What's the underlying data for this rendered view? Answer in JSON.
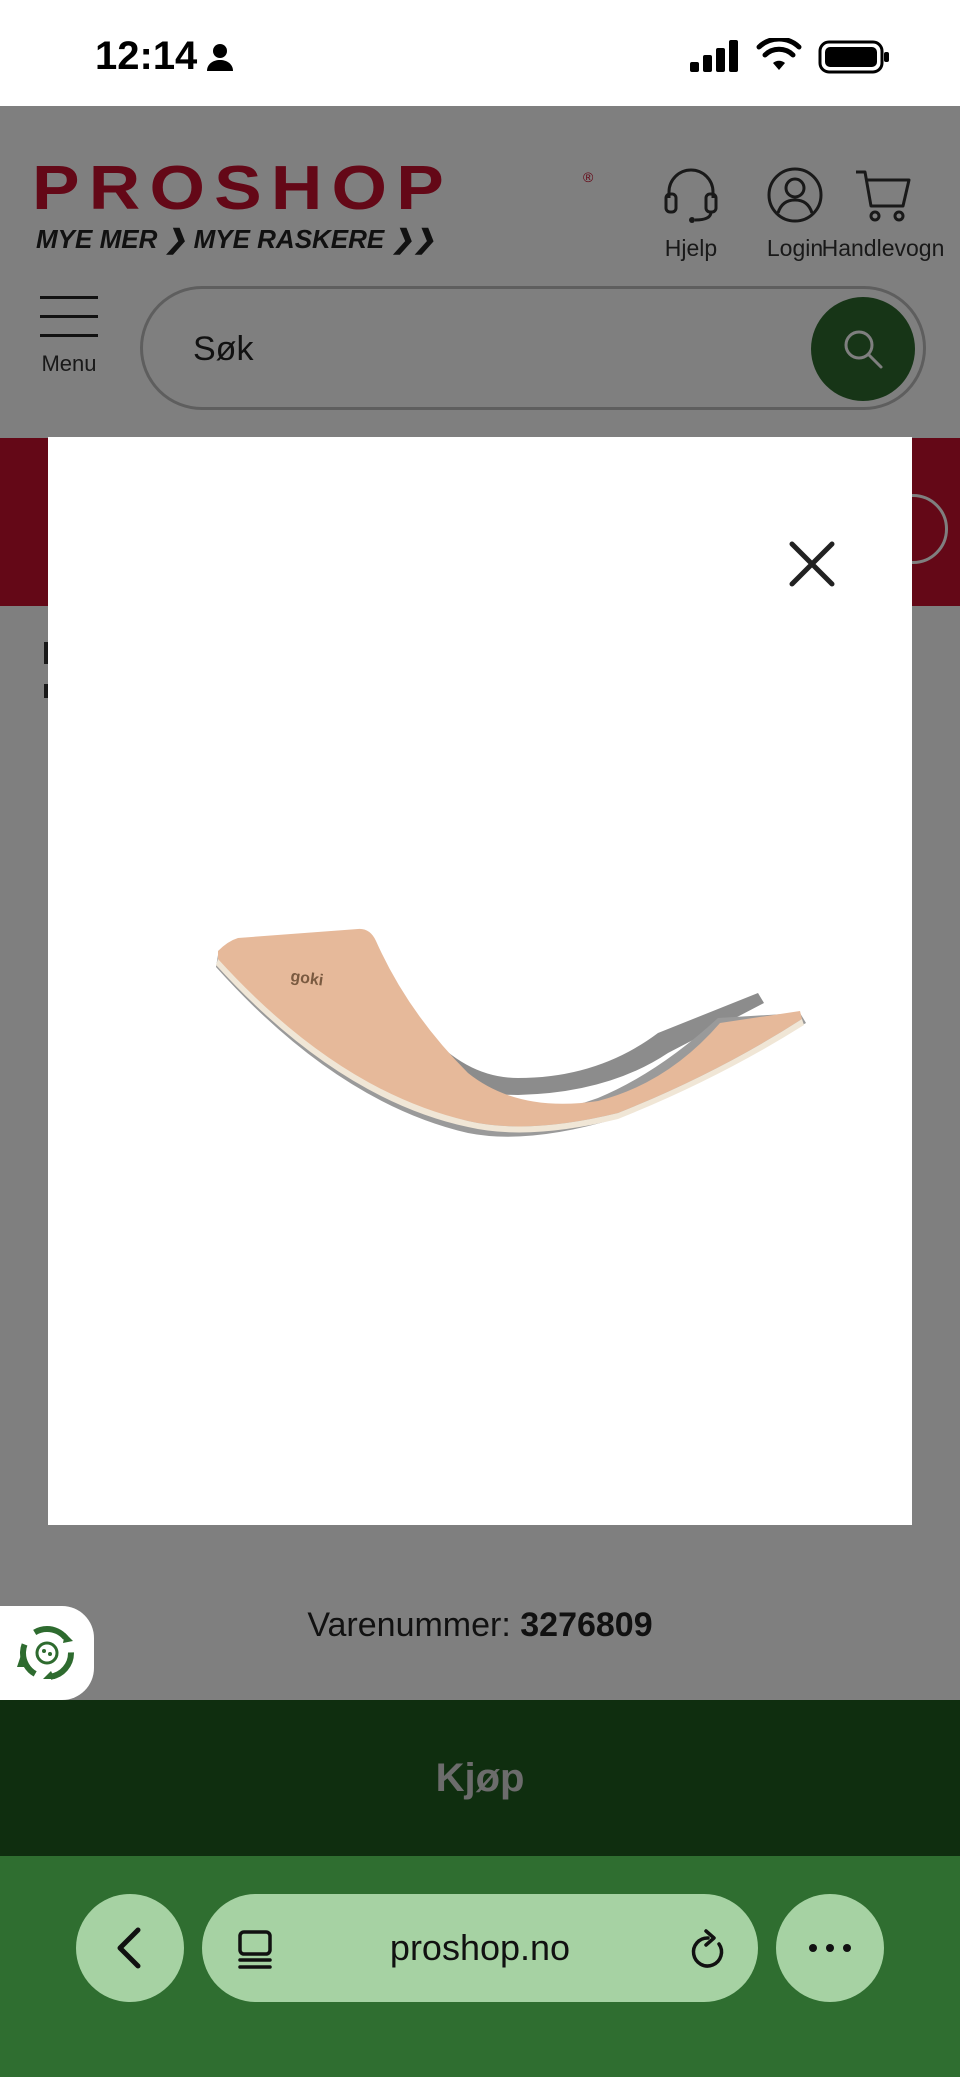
{
  "status_bar": {
    "time": "12:14"
  },
  "header": {
    "logo": "PROSHOP",
    "tagline": "MYE MER ❯ MYE RASKERE ❯❯",
    "help_label": "Hjelp",
    "login_label": "Login",
    "cart_label": "Handlevogn",
    "menu_label": "Menu",
    "search_placeholder": "Søk"
  },
  "product": {
    "image_brand": "goki",
    "sku_label": "Varenummer:",
    "sku_value": "3276809",
    "buy_label": "Kjøp"
  },
  "browser": {
    "url": "proshop.no"
  },
  "colors": {
    "brand_red": "#c8102e",
    "search_green": "#2e6b2f",
    "buy_green": "#1e5d1f",
    "browser_green": "#2f6e30",
    "pill_green": "#a6d2a3"
  }
}
